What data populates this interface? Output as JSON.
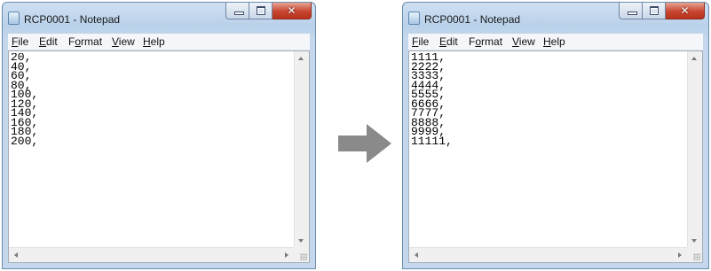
{
  "windows": [
    {
      "title": "RCP0001 - Notepad",
      "menu": [
        {
          "mnemonic": "F",
          "rest": "ile"
        },
        {
          "mnemonic": "E",
          "rest": "dit"
        },
        {
          "pre": "F",
          "mnemonic": "o",
          "rest": "rmat"
        },
        {
          "mnemonic": "V",
          "rest": "iew"
        },
        {
          "mnemonic": "H",
          "rest": "elp"
        }
      ],
      "content": "20,\n40,\n60,\n80,\n100,\n120,\n140,\n160,\n180,\n200,"
    },
    {
      "title": "RCP0001 - Notepad",
      "menu": [
        {
          "mnemonic": "F",
          "rest": "ile"
        },
        {
          "mnemonic": "E",
          "rest": "dit"
        },
        {
          "pre": "F",
          "mnemonic": "o",
          "rest": "rmat"
        },
        {
          "mnemonic": "V",
          "rest": "iew"
        },
        {
          "mnemonic": "H",
          "rest": "elp"
        }
      ],
      "content": "1111,\n2222,\n3333,\n4444,\n5555,\n6666,\n7777,\n8888,\n9999,\n11111,"
    }
  ],
  "icons": {
    "close": "✕",
    "transition_arrow": "right-arrow-icon",
    "arrow_color": "#8a8a8a"
  }
}
